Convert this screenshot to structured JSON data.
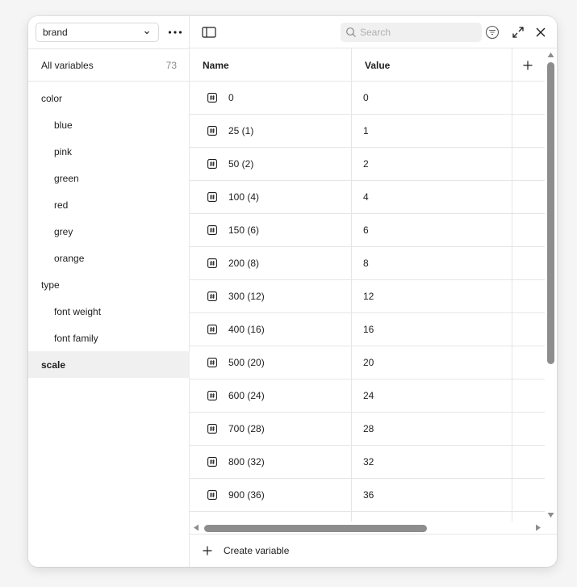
{
  "sidebar": {
    "collection": "brand",
    "all_variables_label": "All variables",
    "all_variables_count": "73",
    "groups": [
      {
        "label": "color",
        "child": false
      },
      {
        "label": "blue",
        "child": true
      },
      {
        "label": "pink",
        "child": true
      },
      {
        "label": "green",
        "child": true
      },
      {
        "label": "red",
        "child": true
      },
      {
        "label": "grey",
        "child": true
      },
      {
        "label": "orange",
        "child": true
      },
      {
        "label": "type",
        "child": false
      },
      {
        "label": "font weight",
        "child": true
      },
      {
        "label": "font family",
        "child": true
      },
      {
        "label": "scale",
        "child": false,
        "active": true
      }
    ]
  },
  "toolbar": {
    "search_placeholder": "Search"
  },
  "table": {
    "headers": {
      "name": "Name",
      "value": "Value"
    },
    "rows": [
      {
        "name": "0",
        "value": "0"
      },
      {
        "name": "25 (1)",
        "value": "1"
      },
      {
        "name": "50 (2)",
        "value": "2"
      },
      {
        "name": "100 (4)",
        "value": "4"
      },
      {
        "name": "150 (6)",
        "value": "6"
      },
      {
        "name": "200 (8)",
        "value": "8"
      },
      {
        "name": "300 (12)",
        "value": "12"
      },
      {
        "name": "400 (16)",
        "value": "16"
      },
      {
        "name": "500 (20)",
        "value": "20"
      },
      {
        "name": "600 (24)",
        "value": "24"
      },
      {
        "name": "700 (28)",
        "value": "28"
      },
      {
        "name": "800 (32)",
        "value": "32"
      },
      {
        "name": "900 (36)",
        "value": "36"
      }
    ]
  },
  "footer": {
    "create_label": "Create variable"
  },
  "icons": {
    "row": "number-variable-icon"
  }
}
